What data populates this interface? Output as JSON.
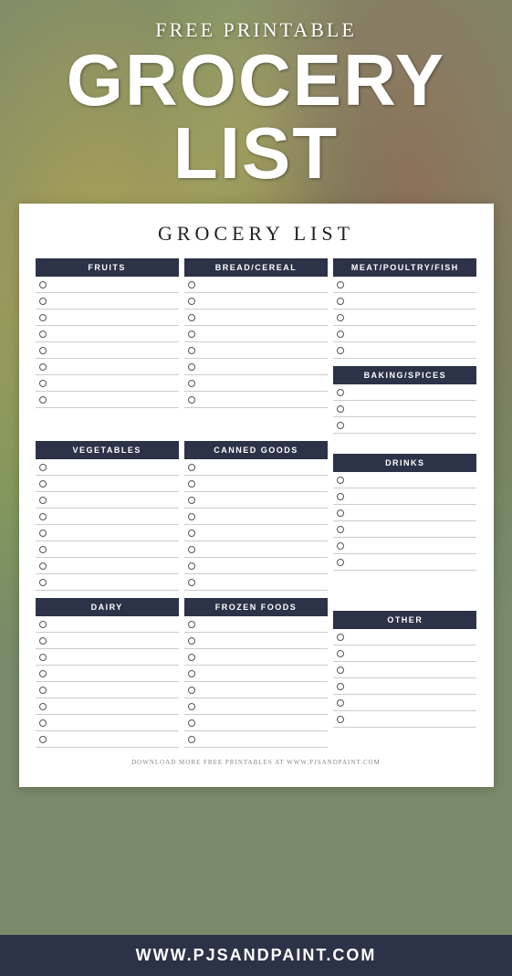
{
  "header": {
    "free_printable": "FREE PRINTABLE",
    "grocery": "GROCERY",
    "list": "LIST"
  },
  "card": {
    "title": "GROCERY LIST",
    "sections": {
      "fruits": "FRUITS",
      "bread_cereal": "BREAD/CEREAL",
      "meat_poultry_fish": "MEAT/POULTRY/FISH",
      "vegetables": "VEGETABLES",
      "canned_goods": "CANNED GOODS",
      "baking_spices": "BAKING/SPICES",
      "dairy": "DAIRY",
      "frozen_foods": "FROZEN FOODS",
      "drinks": "DRINKS",
      "other": "OTHER"
    },
    "footer_text": "DOWNLOAD MORE FREE PRINTABLES AT WWW.PJSANDPAINT.COM"
  },
  "bottom_bar": {
    "url": "WWW.PJSANDPAINT.COM"
  }
}
